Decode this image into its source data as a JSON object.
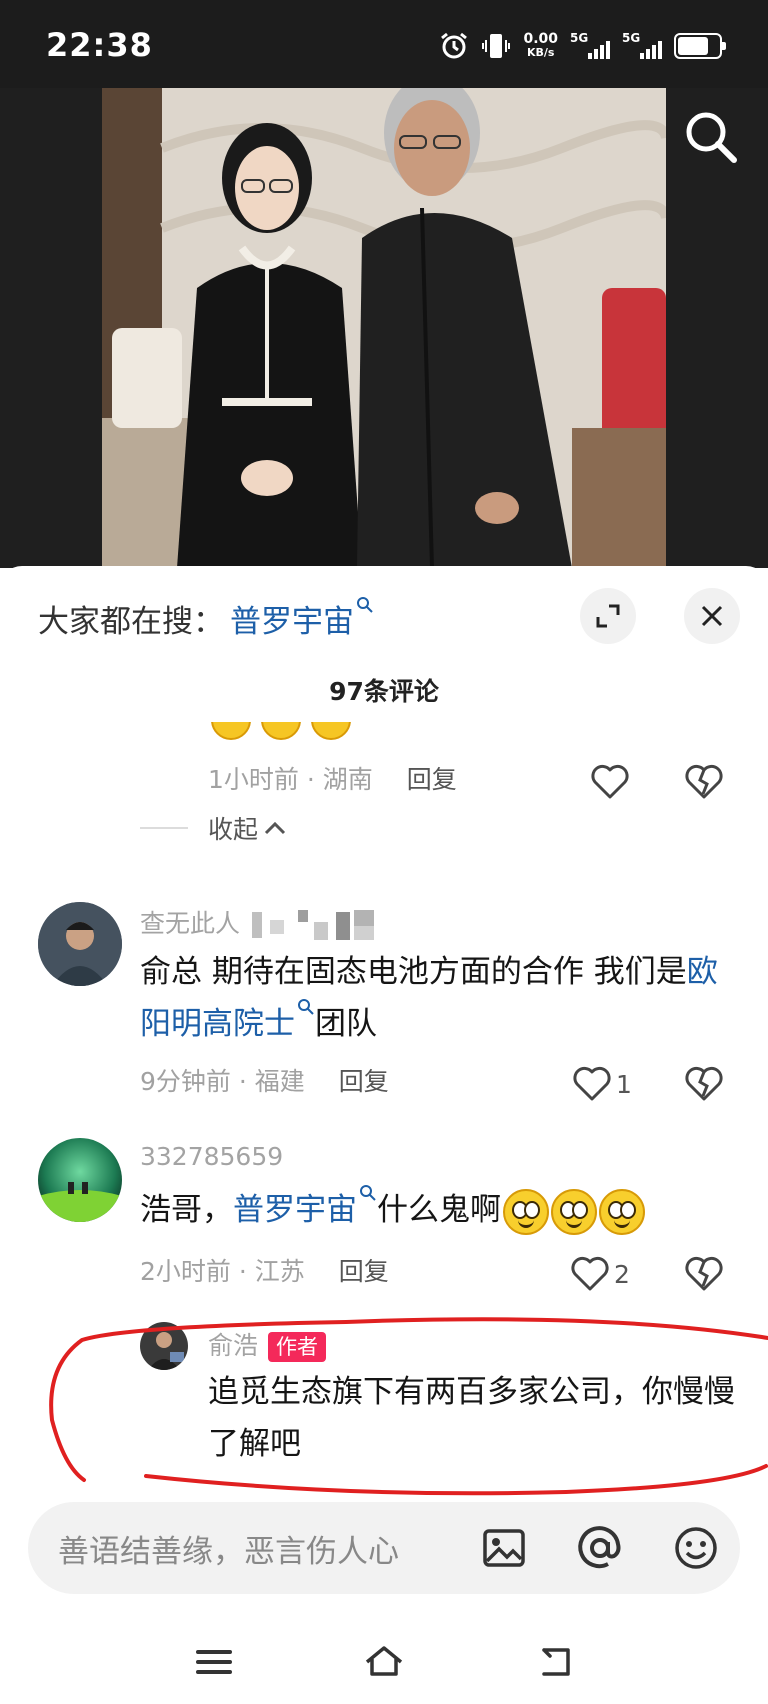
{
  "status_bar": {
    "time": "22:38",
    "net_speed": "0.00",
    "net_unit": "KB/s",
    "sim1_label": "5G",
    "sim2_label": "5G",
    "icons": [
      "alarm-icon",
      "vibrate-icon",
      "signal-icon",
      "signal-icon",
      "battery-icon"
    ]
  },
  "photo": {
    "search_icon": "search-icon"
  },
  "sheet": {
    "hot_search_label": "大家都在搜：",
    "hot_search_term": "普罗宇宙",
    "expand_icon": "expand-icon",
    "close_icon": "close-icon",
    "comment_count": "97条评论"
  },
  "comments": {
    "prev_reply": {
      "time": "1小时前",
      "location": "湖南",
      "separator": " · ",
      "reply": "回复"
    },
    "collapse_label": "收起",
    "c1": {
      "username": "查无此人",
      "text_before": "俞总  期待在固态电池方面的合作  我们是",
      "link": "欧阳明高院士",
      "text_after": "团队",
      "time": "9分钟前",
      "location": "福建",
      "separator": " · ",
      "reply": "回复",
      "likes": "1"
    },
    "c2": {
      "username": "332785659",
      "text_before": "浩哥，",
      "link": "普罗宇宙",
      "text_after": "什么鬼啊",
      "time": "2小时前",
      "location": "江苏",
      "separator": " · ",
      "reply": "回复",
      "likes": "2"
    },
    "c3": {
      "username": "俞浩",
      "badge": "作者",
      "text": "追觅生态旗下有两百多家公司，你慢慢了解吧"
    }
  },
  "input_bar": {
    "placeholder": "善语结善缘，恶言伤人心",
    "icons": [
      "image-icon",
      "at-icon",
      "emoji-icon"
    ]
  },
  "nav_bar": {
    "icons": [
      "menu-icon",
      "home-icon",
      "back-icon"
    ]
  },
  "colors": {
    "link": "#1d5fa8",
    "badge": "#f4295a",
    "annotation": "#e02020"
  }
}
